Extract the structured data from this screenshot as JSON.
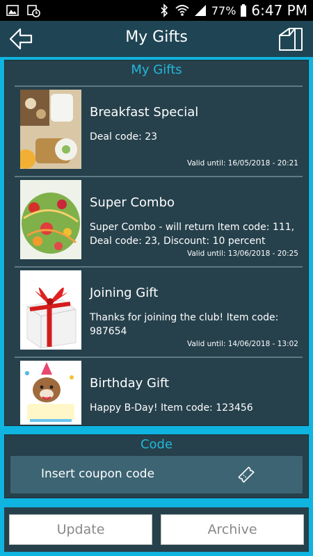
{
  "status_bar": {
    "battery": "77%",
    "time": "6:47 PM"
  },
  "header": {
    "title": "My Gifts",
    "back_icon": "back-arrow-icon",
    "home_icon": "home-icon"
  },
  "gifts_section": {
    "title": "My Gifts",
    "items": [
      {
        "name": "Breakfast Special",
        "description": "Deal code: 23",
        "valid_until": "Valid until: 16/05/2018 - 20:21",
        "image": "breakfast-image"
      },
      {
        "name": "Super Combo",
        "description": "Super Combo - will return Item code: 111, Deal code: 23, Discount: 10 percent",
        "valid_until": "Valid until: 13/06/2018 - 20:25",
        "image": "salad-image"
      },
      {
        "name": "Joining Gift",
        "description": "Thanks for joining the club! Item code: 987654",
        "valid_until": "Valid until: 14/06/2018 - 13:02",
        "image": "gift-box-image"
      },
      {
        "name": "Birthday Gift",
        "description": "Happy B-Day! Item code: 123456",
        "valid_until": "",
        "image": "birthday-image"
      }
    ]
  },
  "code_section": {
    "title": "Code",
    "coupon_placeholder": "Insert coupon code",
    "ticket_icon": "ticket-icon"
  },
  "buttons": {
    "update_label": "Update",
    "archive_label": "Archive"
  },
  "colors": {
    "accent": "#25b6d8",
    "panel": "#26414c",
    "header": "#1f4554",
    "frame": "#0fb4e0"
  }
}
